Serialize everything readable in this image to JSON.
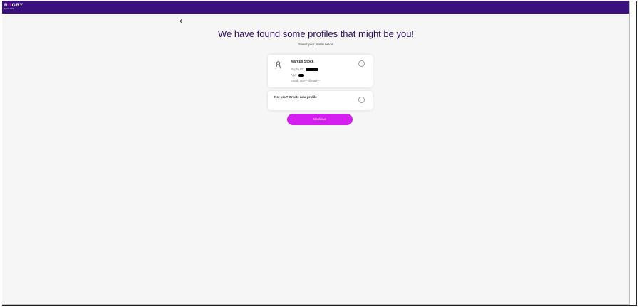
{
  "header": {
    "logo_main_left": "R",
    "logo_main_accent": "U",
    "logo_main_right": "GBY",
    "logo_sub": "ENGLAND"
  },
  "nav": {
    "back_icon": "chevron-left-icon"
  },
  "page": {
    "title": "We have found some profiles that might be you!",
    "subtitle": "Select your profile below"
  },
  "profile": {
    "icon": "person-icon",
    "name": "Marcus Stock",
    "rugby_id_label": "Rugby ID:",
    "age_label": "Age:",
    "email": "Email: mar***@mail***"
  },
  "new_profile": {
    "label": "Not you? Create new profile"
  },
  "continue_label": "Continue",
  "colors": {
    "header_bg": "#3a0f7e",
    "title": "#2a0c5e",
    "button_bg": "#d51ff0",
    "logo_accent": "#e61ef2"
  }
}
